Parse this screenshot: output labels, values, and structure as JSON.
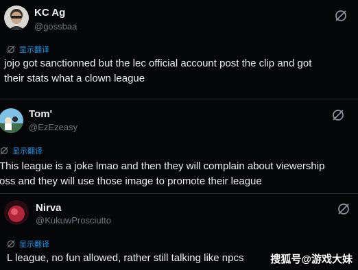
{
  "replies": [
    {
      "name": "KC Ag",
      "handle": "@gossbaa",
      "translate_label": "显示翻译",
      "lines": [
        "jojo got sanctionned but the lec  official account post the clip and got",
        "their stats what a clown league"
      ]
    },
    {
      "name": "Tom'",
      "handle": "@EzEzeasy",
      "translate_label": "显示翻译",
      "lines": [
        "This league is a joke lmao and then they will complain about viewership",
        "oss and they will use those image to promote their league"
      ]
    },
    {
      "name": "Nirva",
      "handle": "@KukuwProsciutto",
      "translate_label": "显示翻译",
      "lines": [
        "L league, no fun allowed, rather still talking like npcs"
      ]
    }
  ],
  "watermark": "搜狐号@游戏大妹",
  "colors": {
    "background": "#050607",
    "link": "#1d9bf0",
    "muted": "#6f767c"
  }
}
